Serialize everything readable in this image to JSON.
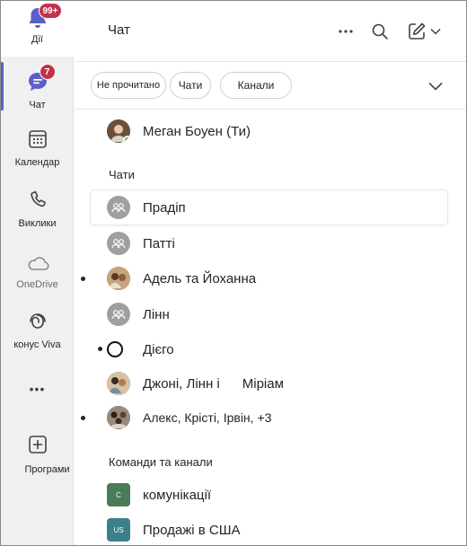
{
  "rail": {
    "activity": {
      "label": "Дії",
      "badge": "99+"
    },
    "chat": {
      "label": "Чат",
      "badge": "7"
    },
    "calendar": {
      "label": "Календар"
    },
    "calls": {
      "label": "Виклики"
    },
    "onedrive": {
      "label": "OneDrive"
    },
    "viva": {
      "label": "конус Viva"
    },
    "more": {
      "label": "•••"
    },
    "apps": {
      "label": "Програми"
    }
  },
  "header": {
    "title": "Чат"
  },
  "filters": {
    "unread": "Не прочитано",
    "chats": "Чати",
    "channels": "Канали"
  },
  "me": {
    "name": "Меган Боуен (Ти)"
  },
  "chats_section": "Чати",
  "chats": [
    {
      "name": "Прадіп",
      "avatar": "group-icon",
      "unread": false,
      "highlighted": true
    },
    {
      "name": "Патті",
      "avatar": "group-icon",
      "unread": false
    },
    {
      "name": "Адель та Йоханна",
      "avatar": "photo",
      "unread": true
    },
    {
      "name": "Лінн",
      "avatar": "group-icon",
      "unread": false
    },
    {
      "name": "Дієго",
      "avatar": "empty-circle",
      "unread": true
    },
    {
      "name": "Джоні, Лінн і      Міріам",
      "avatar": "photo",
      "unread": false
    },
    {
      "name": "Алекс, Крісті, Ірвін, +3",
      "avatar": "photo",
      "unread": true
    }
  ],
  "teams_section": "Команди та канали",
  "teams": [
    {
      "name": "комунікації",
      "initials": "C",
      "color": "#4a7c59"
    },
    {
      "name": "Продажі в США",
      "initials": "US",
      "color": "#3d7f8a"
    }
  ],
  "colors": {
    "accent": "#5b5fc7",
    "badge": "#c4314b",
    "rail_bg": "#f0f0f0"
  }
}
